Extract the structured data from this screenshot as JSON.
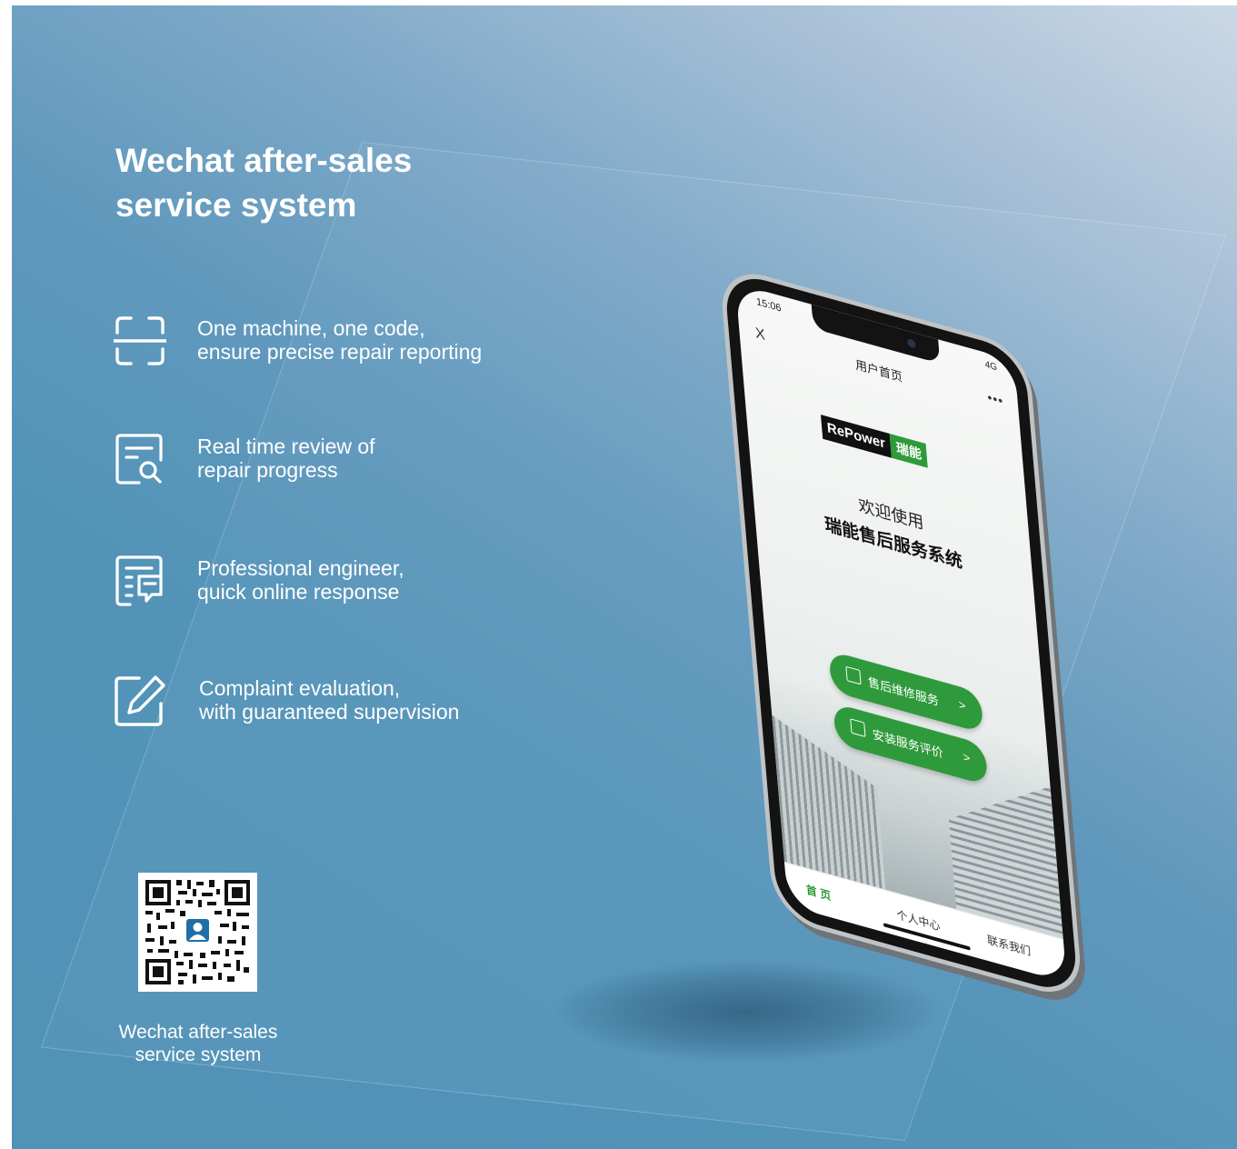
{
  "brochure": {
    "title_line1": "Wechat after-sales",
    "title_line2": "service system",
    "features": [
      {
        "icon": "scan-frame-icon",
        "line1": "One machine, one code,",
        "line2": "ensure precise repair reporting"
      },
      {
        "icon": "document-search-icon",
        "line1": "Real time review of",
        "line2": "repair progress"
      },
      {
        "icon": "document-chat-icon",
        "line1": "Professional engineer,",
        "line2": "quick online response"
      },
      {
        "icon": "edit-pen-icon",
        "line1": "Complaint evaluation,",
        "line2": "with guaranteed supervision"
      }
    ],
    "qr_caption_line1": "Wechat after-sales",
    "qr_caption_line2": "service system"
  },
  "phone": {
    "status_time": "15:06",
    "status_network": "4G",
    "nav_close": "X",
    "nav_title": "用户首页",
    "nav_more": "•••",
    "logo_en": "RePower",
    "logo_cn": "瑞能",
    "welcome": "欢迎使用",
    "system_name": "瑞能售后服务系统",
    "buttons": [
      {
        "label": "售后维修服务",
        "arrow": ">"
      },
      {
        "label": "安装服务评价",
        "arrow": ">"
      }
    ],
    "tabs": [
      {
        "label": "首 页",
        "active": true
      },
      {
        "label": "个人中心",
        "active": false
      },
      {
        "label": "联系我们",
        "active": false
      }
    ]
  },
  "colors": {
    "background_top_right": "#cbd8e6",
    "background_main": "#5192b7",
    "brand_green": "#2f9a3b",
    "text_white": "#ffffff"
  }
}
